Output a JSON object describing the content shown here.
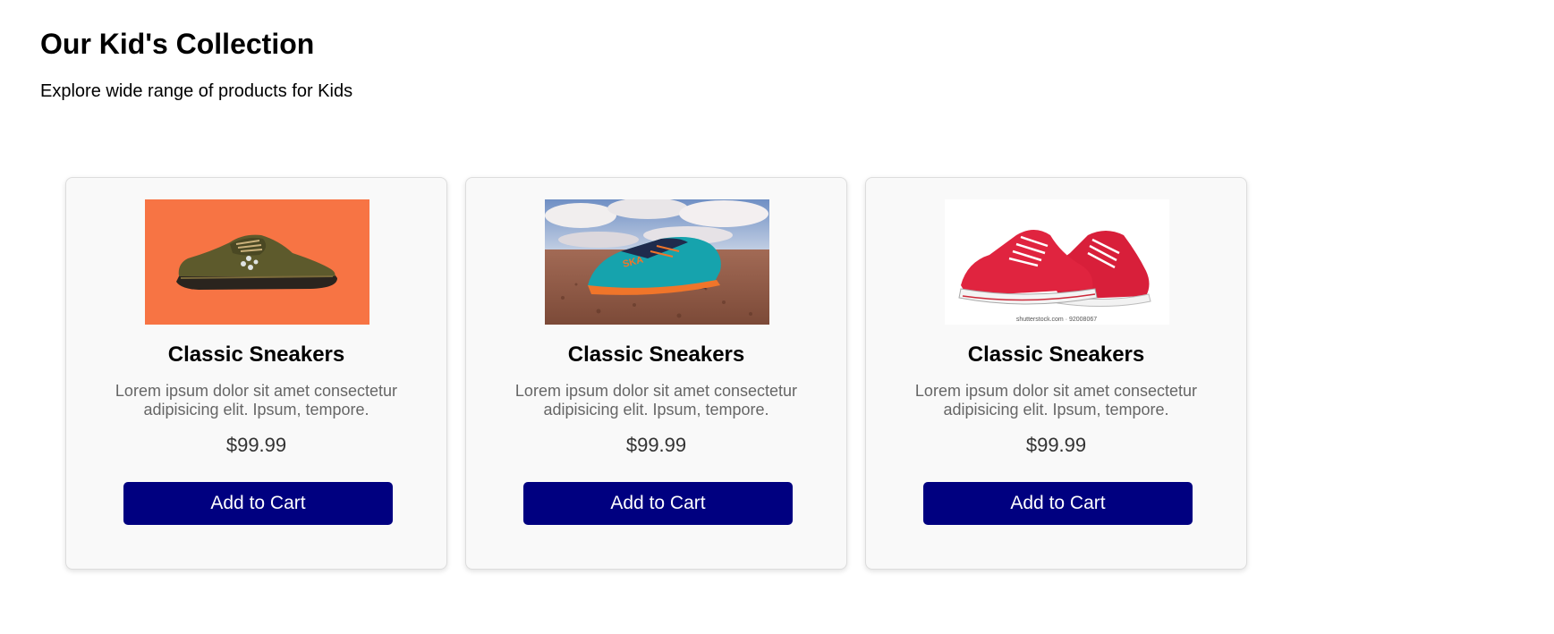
{
  "header": {
    "title": "Our Kid's Collection",
    "subtitle": "Explore wide range of products for Kids"
  },
  "products": [
    {
      "name": "Classic Sneakers",
      "description": "Lorem ipsum dolor sit amet consectetur adipisicing elit. Ipsum, tempore.",
      "price": "$99.99",
      "button_label": "Add to Cart",
      "image": "olive-green-sneaker-on-orange-background",
      "image_alt": "olive green sneaker"
    },
    {
      "name": "Classic Sneakers",
      "description": "Lorem ipsum dolor sit amet consectetur adipisicing elit. Ipsum, tempore.",
      "price": "$99.99",
      "button_label": "Add to Cart",
      "image": "teal-orange-running-shoe-on-desert-ground",
      "image_alt": "teal and orange running shoe"
    },
    {
      "name": "Classic Sneakers",
      "description": "Lorem ipsum dolor sit amet consectetur adipisicing elit. Ipsum, tempore.",
      "price": "$99.99",
      "button_label": "Add to Cart",
      "image": "red-canvas-sneakers-on-white",
      "image_alt": "pair of red canvas sneakers",
      "image_watermark": "shutterstock.com · 92008067"
    }
  ],
  "colors": {
    "button_background": "#000080",
    "card_background": "#f9f9f9",
    "description_text": "#666666"
  }
}
